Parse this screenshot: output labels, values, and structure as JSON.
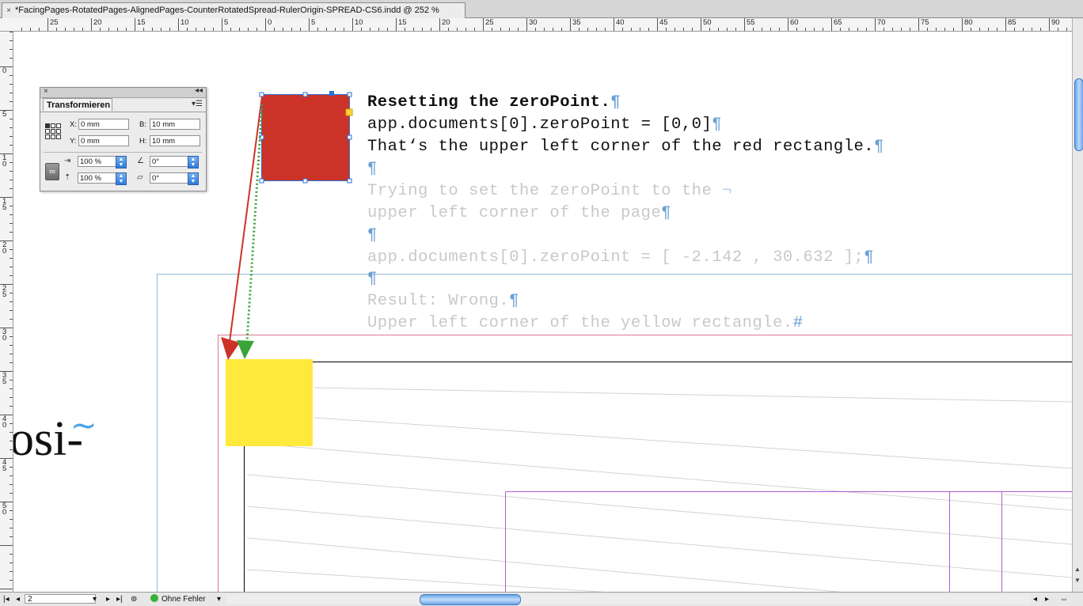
{
  "window": {
    "tab_title": "*FacingPages-RotatedPages-AlignedPages-CounterRotatedSpread-RulerOrigin-SPREAD-CS6.indd @ 252 %",
    "close_glyph": "×"
  },
  "rulers": {
    "horizontal_labels": [
      "25",
      "20",
      "15",
      "10",
      "5",
      "0",
      "5",
      "10",
      "15",
      "20",
      "25",
      "30",
      "35",
      "40",
      "45",
      "50",
      "55",
      "60",
      "65",
      "70",
      "75",
      "80",
      "85",
      "90"
    ],
    "vertical_labels": [
      "5",
      "0",
      "5",
      "10",
      "15",
      "20",
      "25",
      "30",
      "35",
      "40",
      "45",
      "50"
    ]
  },
  "document_text": {
    "line1": "Resetting the zeroPoint.",
    "line2": "app.documents[0].zeroPoint = [0,0]",
    "line3": "That‘s the upper left corner of the red rectangle.",
    "line5": "Trying to set the zeroPoint to the ",
    "line6": "upper left corner of the page",
    "line8": "app.documents[0].zeroPoint = [ -2.142 , 30.632 ];",
    "line10": "Result: Wrong.",
    "line11": "Upper left corner of the yellow rectangle.",
    "pilcrow": "¶",
    "discretionary_break": "¬",
    "end_of_story": "#",
    "background_text": "osi-",
    "background_tilde": "~"
  },
  "colors": {
    "red_rectangle": "#cc3328",
    "yellow_rectangle": "#ffe93c",
    "red_arrow": "#cc3328",
    "green_arrow": "#3aa33a",
    "selection_handle": "#2a6fd6"
  },
  "transform_panel": {
    "title": "Transformieren",
    "x_label": "X:",
    "x_value": "0 mm",
    "y_label": "Y:",
    "y_value": "0 mm",
    "w_label": "B:",
    "w_value": "10 mm",
    "h_label": "H:",
    "h_value": "10 mm",
    "scale_x": "100 %",
    "scale_y": "100 %",
    "rotation": "0°",
    "shear": "0°"
  },
  "status_bar": {
    "page_number": "2",
    "preflight_status": "Ohne Fehler"
  }
}
